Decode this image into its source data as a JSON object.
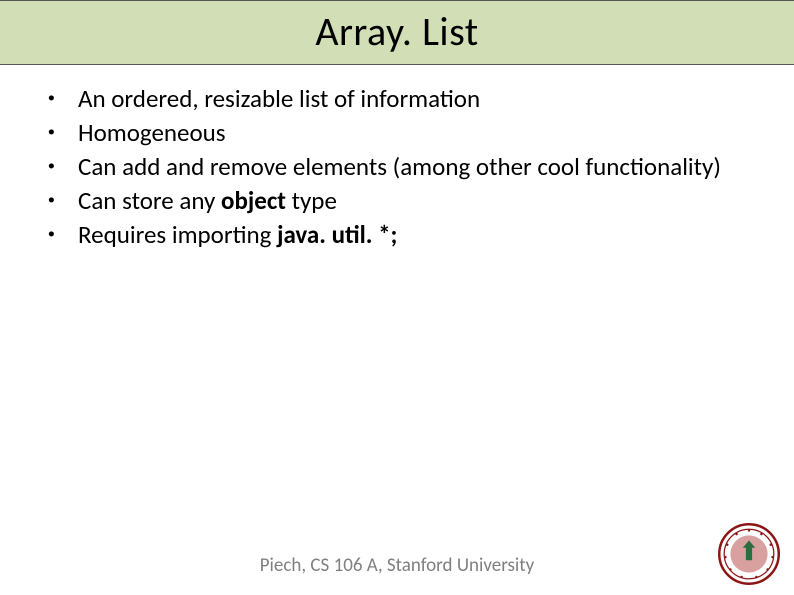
{
  "title": "Array. List",
  "bullets": [
    {
      "html": "An ordered, resizable list of information"
    },
    {
      "html": "Homogeneous"
    },
    {
      "html": "Can add and remove elements (among other cool functionality)"
    },
    {
      "html": "Can store any <b>object</b> type"
    },
    {
      "html": "Requires importing <b>java. util. *;</b>"
    }
  ],
  "footer": "Piech, CS 106 A, Stanford University",
  "seal": {
    "name": "stanford-seal",
    "ring_color": "#8c1515",
    "inner_color": "#c55a5a",
    "accent_color": "#2a6e3f"
  }
}
